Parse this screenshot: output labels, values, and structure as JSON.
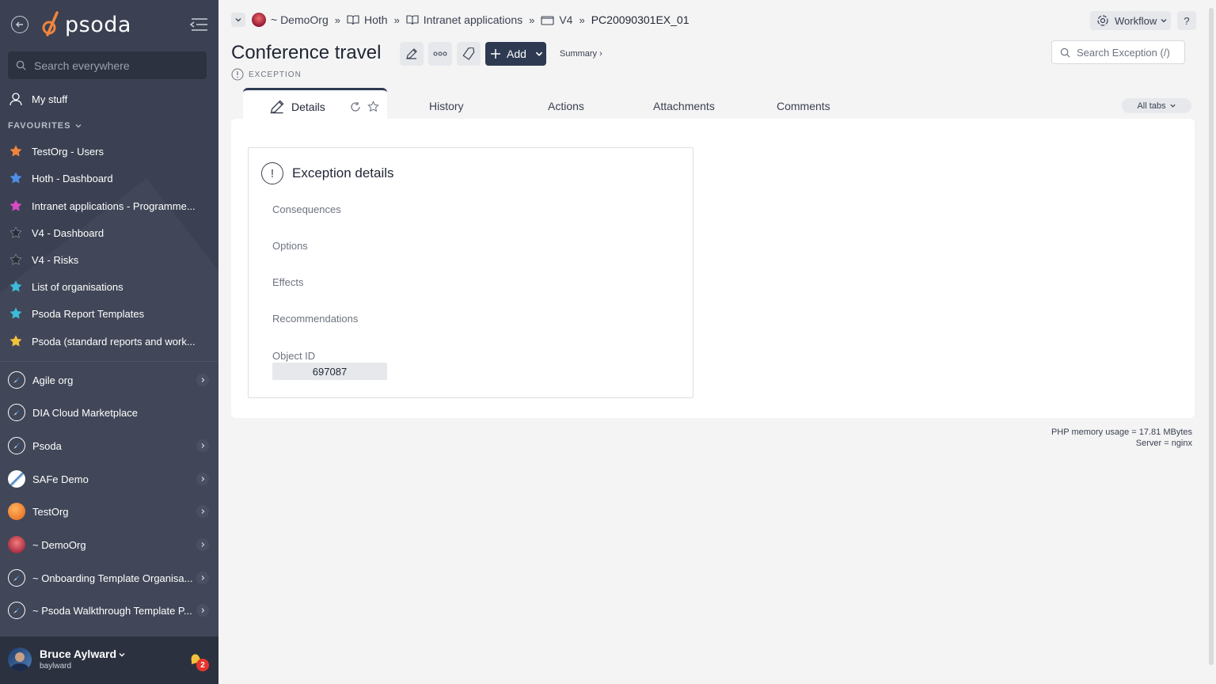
{
  "sidebar": {
    "logo_text": "psoda",
    "search_placeholder": "Search everywhere",
    "my_stuff": "My stuff",
    "favourites_header": "FAVOURITES",
    "favourites": [
      {
        "label": "TestOrg - Users",
        "color": "#f0843c"
      },
      {
        "label": "Hoth - Dashboard",
        "color": "#4f8ee8"
      },
      {
        "label": "Intranet applications - Programme...",
        "color": "#d94bc4"
      },
      {
        "label": "V4 - Dashboard",
        "color": "#2a2e38"
      },
      {
        "label": "V4 - Risks",
        "color": "#2a2e38"
      },
      {
        "label": "List of organisations",
        "color": "#3cbcd8"
      },
      {
        "label": "Psoda Report Templates",
        "color": "#3cbcd8"
      },
      {
        "label": "Psoda (standard reports and work...",
        "color": "#f2c23a"
      }
    ],
    "organisations": [
      {
        "label": "Agile org",
        "icon": "compass-icon",
        "has_chevron": true
      },
      {
        "label": "DIA Cloud Marketplace",
        "icon": "compass-icon",
        "has_chevron": false
      },
      {
        "label": "Psoda",
        "icon": "compass-icon",
        "has_chevron": true
      },
      {
        "label": "SAFe Demo",
        "icon": "safe-logo-icon",
        "has_chevron": true
      },
      {
        "label": "TestOrg",
        "icon": "orange-orb-icon",
        "has_chevron": true
      },
      {
        "label": "~ DemoOrg",
        "icon": "sunset-orb-icon",
        "has_chevron": true
      },
      {
        "label": "~ Onboarding Template Organisa...",
        "icon": "compass-icon",
        "has_chevron": true
      },
      {
        "label": "~ Psoda Walkthrough Template P...",
        "icon": "compass-icon",
        "has_chevron": true
      }
    ],
    "user": {
      "name": "Bruce Aylward",
      "handle": "baylward",
      "notifications": "2"
    }
  },
  "breadcrumbs": [
    {
      "label": "~ DemoOrg",
      "icon": "org-icon"
    },
    {
      "label": "Hoth",
      "icon": "book-icon"
    },
    {
      "label": "Intranet applications",
      "icon": "book-icon"
    },
    {
      "label": "V4",
      "icon": "folder-icon"
    },
    {
      "label": "PC20090301EX_01",
      "icon": ""
    }
  ],
  "header": {
    "workflow_label": "Workflow",
    "help_label": "?",
    "title": "Conference travel",
    "add_label": "Add",
    "summary_label": "Summary ›",
    "type_label": "EXCEPTION",
    "search_placeholder": "Search Exception (/)"
  },
  "tabs": {
    "active": "Details",
    "others": [
      "History",
      "Actions",
      "Attachments",
      "Comments"
    ],
    "all_tabs_label": "All tabs"
  },
  "card": {
    "title": "Exception details",
    "fields": [
      "Consequences",
      "Options",
      "Effects",
      "Recommendations"
    ],
    "object_id_label": "Object ID",
    "object_id_value": "697087"
  },
  "footer": {
    "memory": "PHP memory usage = 17.81 MBytes",
    "server": "Server = nginx"
  },
  "colors": {
    "sidebar_bg": "#3b4152",
    "primary_button": "#2d3a52",
    "logo_accent": "#f0843c"
  }
}
